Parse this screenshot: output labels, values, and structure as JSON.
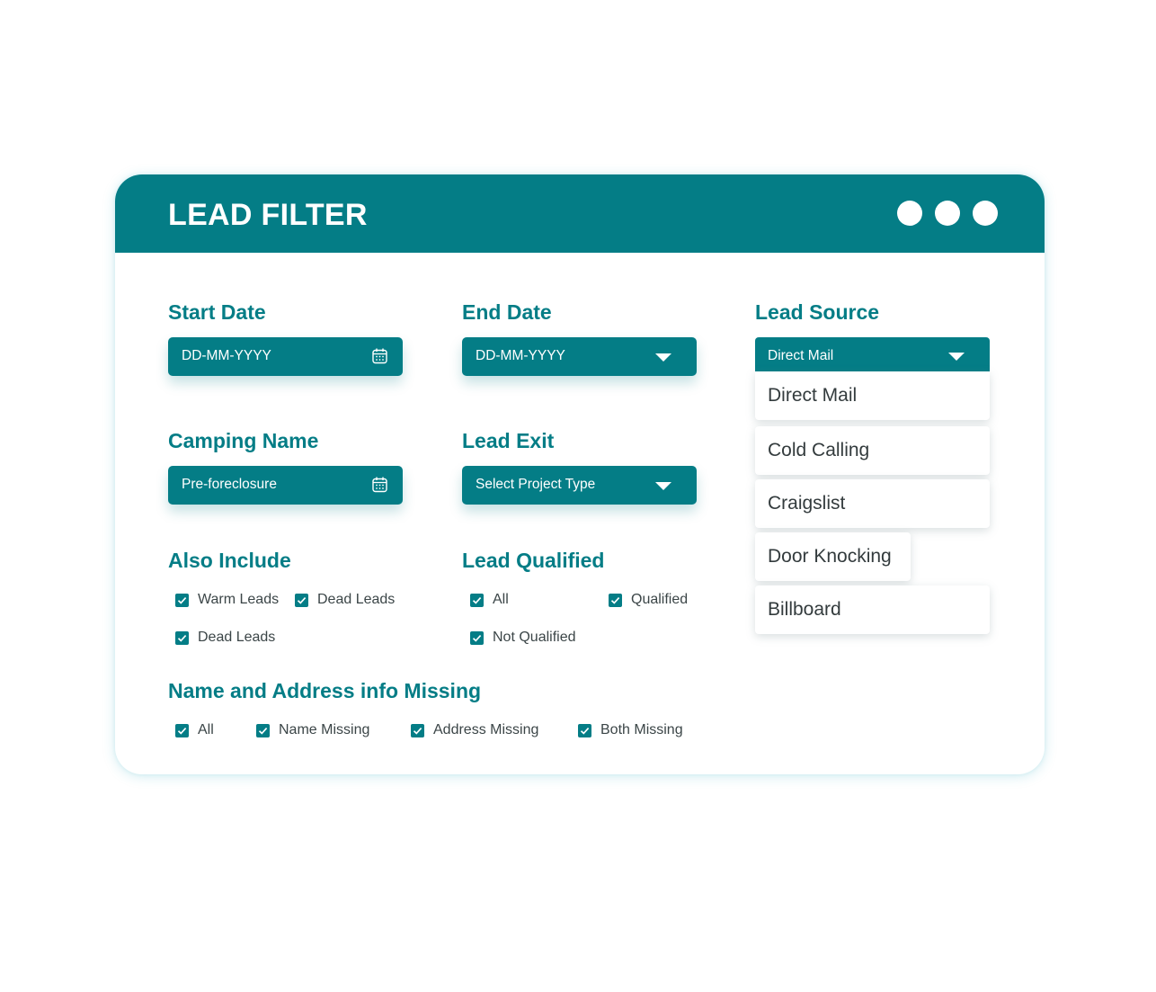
{
  "window": {
    "title": "LEAD FILTER",
    "accent_color": "#047d86",
    "window_controls": [
      "dot",
      "dot",
      "dot"
    ]
  },
  "start_date": {
    "label": "Start Date",
    "value": "DD-MM-YYYY",
    "icon": "calendar-icon"
  },
  "end_date": {
    "label": "End Date",
    "value": "DD-MM-YYYY",
    "icon": "caret-down-icon"
  },
  "lead_source": {
    "label": "Lead Source",
    "selected": "Direct Mail",
    "icon": "caret-down-icon",
    "options": [
      "Direct Mail",
      "Cold Calling",
      "Craigslist",
      "Door Knocking",
      "Billboard"
    ]
  },
  "camping_name": {
    "label": "Camping Name",
    "value": "Pre-foreclosure",
    "icon": "calendar-icon"
  },
  "lead_exit": {
    "label": "Lead Exit",
    "value": "Select Project Type",
    "icon": "caret-down-icon"
  },
  "also_include": {
    "label": "Also Include",
    "options": [
      {
        "label": "Warm Leads",
        "checked": true
      },
      {
        "label": "Dead Leads",
        "checked": true
      },
      {
        "label": "Dead Leads",
        "checked": true
      }
    ]
  },
  "lead_qualified": {
    "label": "Lead Qualified",
    "options": [
      {
        "label": "All",
        "checked": true
      },
      {
        "label": "Qualified",
        "checked": true
      },
      {
        "label": "Not Qualified",
        "checked": true
      }
    ]
  },
  "missing_info": {
    "label": "Name and Address info Missing",
    "options": [
      {
        "label": "All",
        "checked": true
      },
      {
        "label": "Name Missing",
        "checked": true
      },
      {
        "label": "Address Missing",
        "checked": true
      },
      {
        "label": "Both Missing",
        "checked": true
      }
    ]
  }
}
